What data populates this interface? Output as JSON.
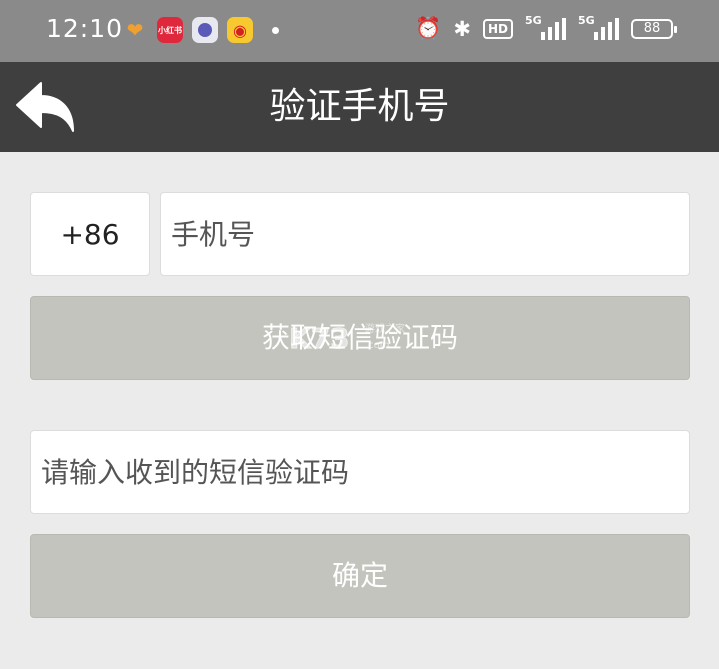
{
  "status_bar": {
    "time": "12:10",
    "notification_icons": [
      "heart-icon",
      "xiaohongshu-icon",
      "app-icon",
      "weibo-icon"
    ],
    "xiaohongshu_label": "小红书",
    "hd_label": "HD",
    "signal_label_1": "5G",
    "signal_label_2": "5G",
    "battery": "88"
  },
  "header": {
    "title": "验证手机号"
  },
  "form": {
    "country_code": "+86",
    "phone_placeholder": "手机号",
    "get_code_label": "获取短信验证码",
    "code_placeholder": "请输入收到的短信验证码",
    "confirm_label": "确定"
  },
  "colors": {
    "status_bar": "#8a8a8a",
    "title_bar": "#3f3f3f",
    "background": "#ebebeb",
    "button_disabled": "#c2c4bd"
  }
}
